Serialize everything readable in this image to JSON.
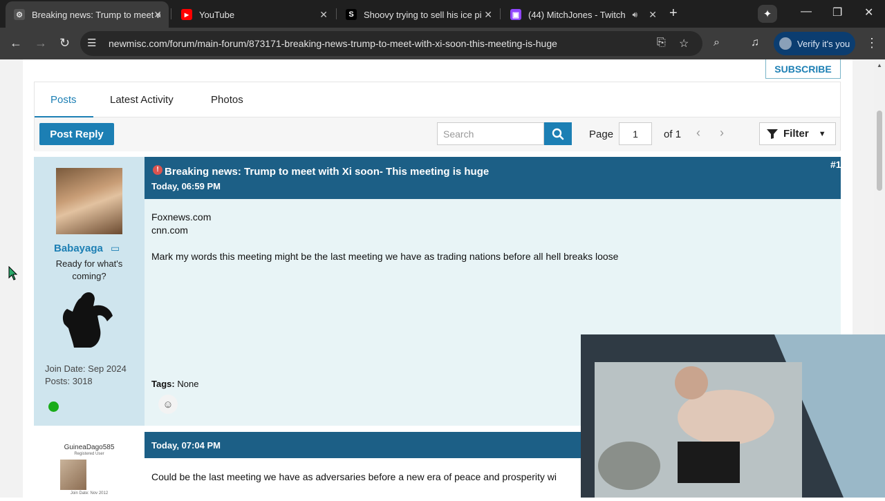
{
  "browser": {
    "tabs": [
      {
        "title": "Breaking news: Trump to meet w",
        "icon": "forum-favicon-icon",
        "active": true
      },
      {
        "title": "YouTube",
        "icon": "youtube-icon",
        "active": false
      },
      {
        "title": "Shoovy trying to sell his ice piss",
        "icon": "s-favicon-icon",
        "active": false
      },
      {
        "title": "(44) MitchJones - Twitch",
        "icon": "twitch-icon",
        "active": false
      }
    ],
    "url": "newmisc.com/forum/main-forum/873171-breaking-news-trump-to-meet-with-xi-soon-this-meeting-is-huge",
    "verify_label": "Verify it's you"
  },
  "forum": {
    "subscribe_label": "SUBSCRIBE",
    "tabs": [
      "Posts",
      "Latest Activity",
      "Photos"
    ],
    "post_reply_label": "Post Reply",
    "search_placeholder": "Search",
    "page_label": "Page",
    "page_value": "1",
    "of_label": "of",
    "total_pages": "1",
    "filter_label": "Filter"
  },
  "post1": {
    "username": "Babayaga",
    "user_title": "Ready for what's coming?",
    "join_date": "Join Date: Sep 2024",
    "posts": "Posts: 3018",
    "title": "Breaking news: Trump to meet with Xi soon- This meeting is huge",
    "date": "Today, 06:59 PM",
    "number": "#1",
    "body": [
      "Foxnews.com",
      "cnn.com",
      "",
      "Mark my words this meeting might be the last meeting we have as trading nations before all hell breaks loose"
    ],
    "tags_label": "Tags:",
    "tags_value": "None"
  },
  "post2": {
    "username": "GuineaDago585",
    "rank": "Registered User",
    "join_date": "Join Date: Nov 2012",
    "date": "Today, 07:04 PM",
    "body": "Could be the last meeting we have as adversaries before a new era of peace and prosperity wi"
  },
  "colors": {
    "accent": "#1c7fb4",
    "post_header": "#1c5f86",
    "post_bg": "#e8f4f6",
    "userpane_bg": "#cfe5ee",
    "online": "#1aac1a"
  }
}
